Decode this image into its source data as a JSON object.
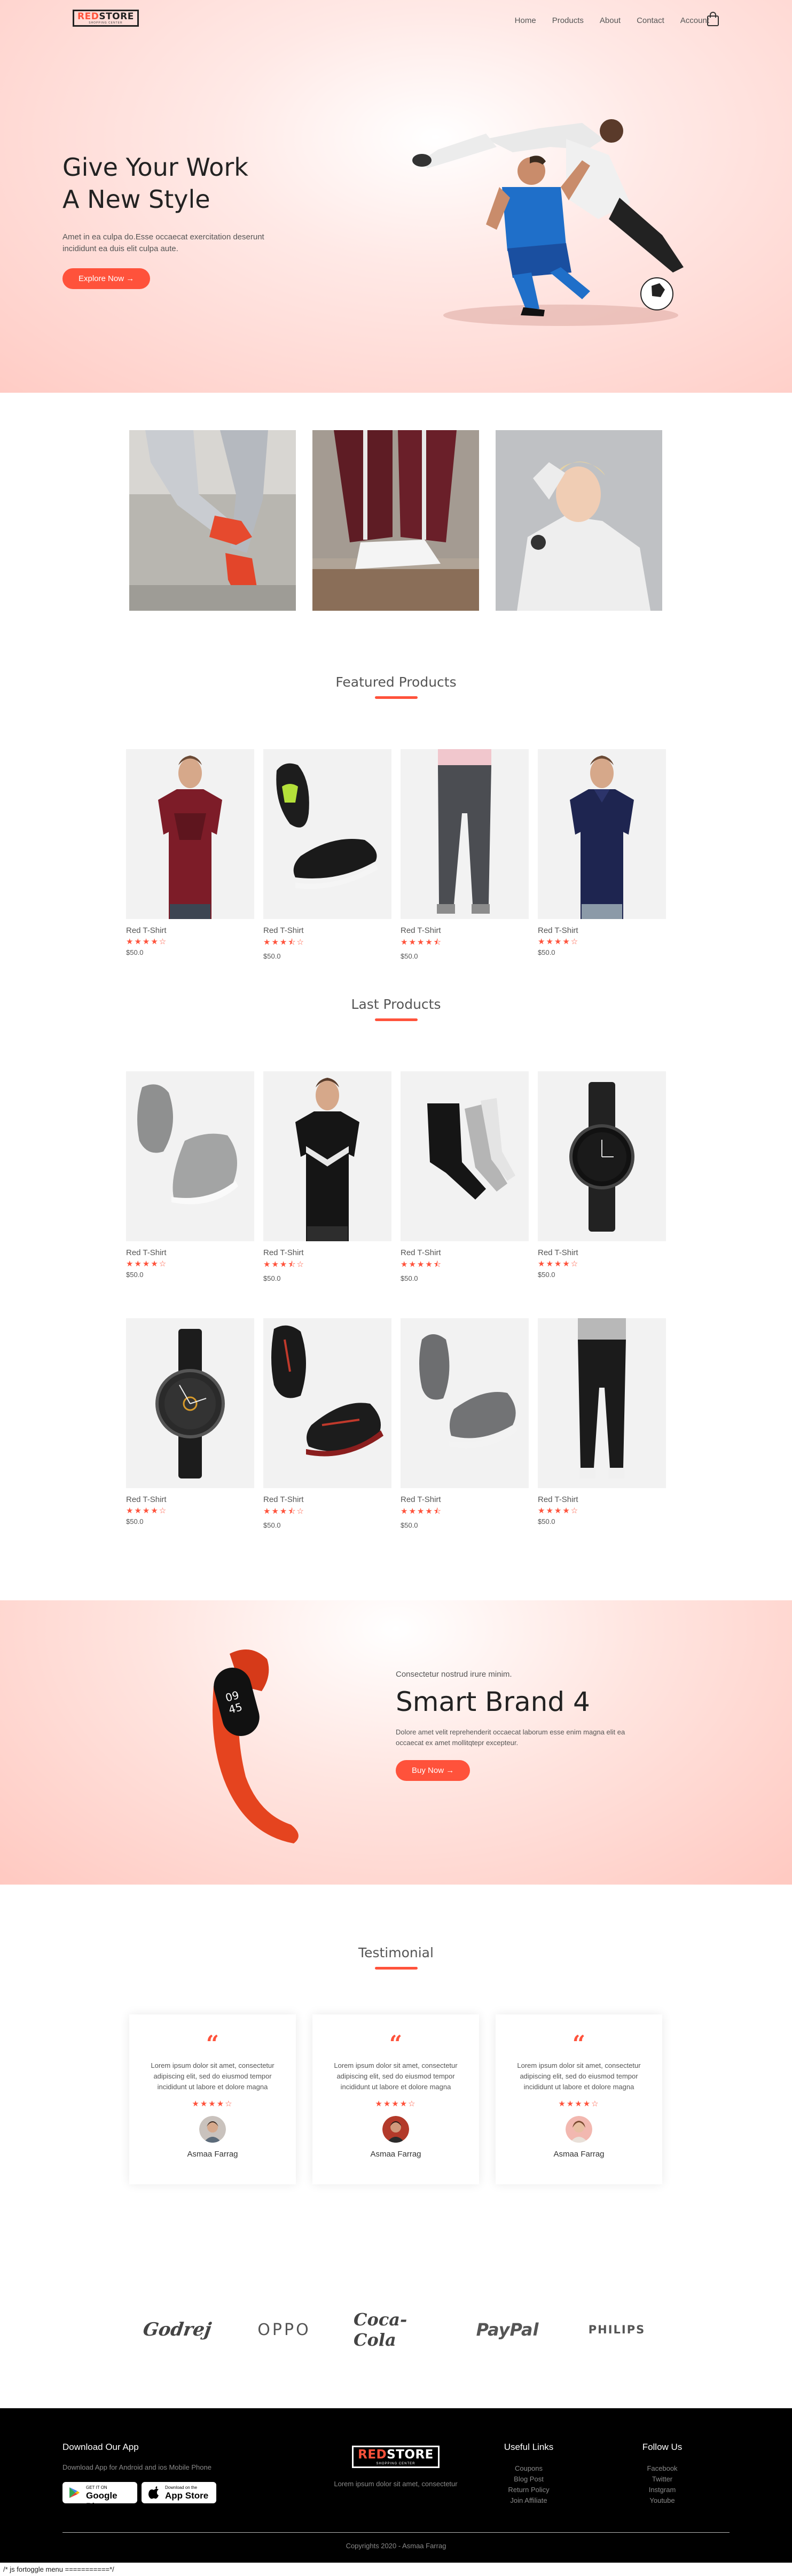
{
  "header": {
    "logo_text_red": "RED",
    "logo_text_dark": "STORE",
    "logo_tagline": "SHOPPING CENTER",
    "nav": [
      "Home",
      "Products",
      "About",
      "Contact",
      "Account"
    ]
  },
  "hero": {
    "title_line1": "Give Your Work",
    "title_line2": "A New Style",
    "text_line1": "Amet in ea culpa do.Esse occaecat exercitation deserunt",
    "text_line2": "incididunt ea duis elit culpa aute.",
    "button": "Explore Now →"
  },
  "featured": {
    "title": "Featured Products",
    "products": [
      {
        "name": "Red T-Shirt",
        "stars": "★★★★☆",
        "price": "$50.0"
      },
      {
        "name": "Red T-Shirt",
        "stars": "★★★⯪☆",
        "price": "$50.0"
      },
      {
        "name": "Red T-Shirt",
        "stars": "★★★★⯪",
        "price": "$50.0"
      },
      {
        "name": "Red T-Shirt",
        "stars": "★★★★☆",
        "price": "$50.0"
      }
    ]
  },
  "latest": {
    "title": "Last Products",
    "products": [
      {
        "name": "Red T-Shirt",
        "stars": "★★★★☆",
        "price": "$50.0"
      },
      {
        "name": "Red T-Shirt",
        "stars": "★★★⯪☆",
        "price": "$50.0"
      },
      {
        "name": "Red T-Shirt",
        "stars": "★★★★⯪",
        "price": "$50.0"
      },
      {
        "name": "Red T-Shirt",
        "stars": "★★★★☆",
        "price": "$50.0"
      },
      {
        "name": "Red T-Shirt",
        "stars": "★★★★☆",
        "price": "$50.0"
      },
      {
        "name": "Red T-Shirt",
        "stars": "★★★⯪☆",
        "price": "$50.0"
      },
      {
        "name": "Red T-Shirt",
        "stars": "★★★★⯪",
        "price": "$50.0"
      },
      {
        "name": "Red T-Shirt",
        "stars": "★★★★☆",
        "price": "$50.0"
      }
    ]
  },
  "offer": {
    "subtitle": "Consectetur nostrud irure minim.",
    "title": "Smart Brand 4",
    "text_line1": "Dolore amet velit reprehenderit occaecat laborum esse enim magna elit ea",
    "text_line2": "occaecat ex amet mollitqtepr excepteur.",
    "button": "Buy Now →"
  },
  "testimonial": {
    "title": "Testimonial",
    "items": [
      {
        "quote": "“",
        "text": "Lorem ipsum dolor sit amet, consectetur adipiscing elit, sed do eiusmod tempor incididunt ut labore et dolore magna",
        "stars": "★★★★☆",
        "name": "Asmaa Farrag"
      },
      {
        "quote": "“",
        "text": "Lorem ipsum dolor sit amet, consectetur adipiscing elit, sed do eiusmod tempor incididunt ut labore et dolore magna",
        "stars": "★★★★☆",
        "name": "Asmaa Farrag"
      },
      {
        "quote": "“",
        "text": "Lorem ipsum dolor sit amet, consectetur adipiscing elit, sed do eiusmod tempor incididunt ut labore et dolore magna",
        "stars": "★★★★☆",
        "name": "Asmaa Farrag"
      }
    ]
  },
  "brands": [
    "Godrej",
    "OPPO",
    "Coca-Cola",
    "PayPal",
    "PHILIPS"
  ],
  "footer": {
    "app_title": "Download Our App",
    "app_text": "Download App for Android and ios Mobile Phone",
    "google_small": "GET IT ON",
    "google_big": "Google Play",
    "apple_small": "Download on the",
    "apple_big": "App Store",
    "logo_text_red": "RED",
    "logo_text_light": "STORE",
    "logo_tagline": "SHOPPING CENTER",
    "center_text": "Lorem ipsum dolor sit amet, consectetur",
    "links_title": "Useful Links",
    "links": [
      "Coupons",
      "Blog Post",
      "Return Policy",
      "Join Affiliate"
    ],
    "follow_title": "Follow Us",
    "follow": [
      "Facebook",
      "Twitter",
      "Instgram",
      "Youtube"
    ],
    "copyright": "Copyrights 2020 - Asmaa Farrag"
  },
  "js_comment": "/* js fortoggle menu ===========*/",
  "colors": {
    "accent": "#ff523b",
    "footer_bg": "#000000",
    "hero_pink": "#ffccc5"
  }
}
